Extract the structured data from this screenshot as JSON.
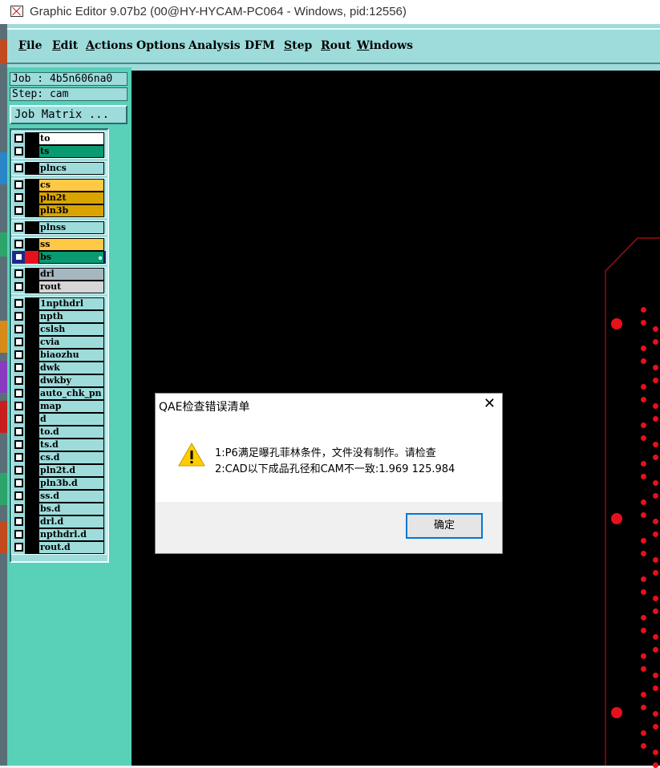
{
  "window": {
    "title": "Graphic Editor 9.07b2 (00@HY-HYCAM-PC064 - Windows, pid:12556)"
  },
  "menubar": {
    "items": [
      {
        "label": "File",
        "underline": true
      },
      {
        "label": "Edit",
        "underline": true
      },
      {
        "label": "Actions",
        "underline": true
      },
      {
        "label": "Options",
        "underline": false
      },
      {
        "label": "Analysis",
        "underline": false
      },
      {
        "label": "DFM",
        "underline": false
      },
      {
        "label": "Step",
        "underline": true
      },
      {
        "label": "Rout",
        "underline": true
      },
      {
        "label": "Windows",
        "underline": true
      }
    ]
  },
  "sidebar": {
    "job": "Job : 4b5n606na0",
    "step": "Step: cam",
    "job_matrix": "Job Matrix ..."
  },
  "layers": [
    {
      "name": "to",
      "color": "#ffffff"
    },
    {
      "name": "ts",
      "color": "#0a9a72"
    },
    {
      "name": "plncs",
      "color": "#9edcdc"
    },
    {
      "name": "cs",
      "color": "#ffc845"
    },
    {
      "name": "pln2t",
      "color": "#d9a400"
    },
    {
      "name": "pln3b",
      "color": "#d9a400"
    },
    {
      "name": "plnss",
      "color": "#9edcdc"
    },
    {
      "name": "ss",
      "color": "#ffc845"
    },
    {
      "name": "bs",
      "color": "#0a9a72",
      "active": true,
      "display_color": "#e8101a"
    },
    {
      "name": "drl",
      "color": "#a7b7bf"
    },
    {
      "name": "rout",
      "color": "#d6d6d6"
    },
    {
      "name": "1npthdrl",
      "color": "#9edcdc"
    },
    {
      "name": "npth",
      "color": "#9edcdc"
    },
    {
      "name": "cslsh",
      "color": "#9edcdc"
    },
    {
      "name": "cvia",
      "color": "#9edcdc"
    },
    {
      "name": "biaozhu",
      "color": "#9edcdc"
    },
    {
      "name": "dwk",
      "color": "#9edcdc"
    },
    {
      "name": "dwkby",
      "color": "#9edcdc"
    },
    {
      "name": "auto_chk_pn",
      "color": "#9edcdc"
    },
    {
      "name": "map",
      "color": "#9edcdc"
    },
    {
      "name": "d",
      "color": "#9edcdc"
    },
    {
      "name": "to.d",
      "color": "#9edcdc"
    },
    {
      "name": "ts.d",
      "color": "#9edcdc"
    },
    {
      "name": "cs.d",
      "color": "#9edcdc"
    },
    {
      "name": "pln2t.d",
      "color": "#9edcdc"
    },
    {
      "name": "pln3b.d",
      "color": "#9edcdc"
    },
    {
      "name": "ss.d",
      "color": "#9edcdc"
    },
    {
      "name": "bs.d",
      "color": "#9edcdc"
    },
    {
      "name": "drl.d",
      "color": "#9edcdc"
    },
    {
      "name": "npthdrl.d",
      "color": "#9edcdc"
    },
    {
      "name": "rout.d",
      "color": "#9edcdc"
    }
  ],
  "dialog": {
    "title": "QAE检查错误清单",
    "close": "✕",
    "icon": "warning-icon",
    "line1": "1:P6满足曝孔菲林条件，文件没有制作。请检查",
    "line2": "2:CAD以下成品孔径和CAM不一致:1.969 125.984",
    "ok": "确定"
  }
}
